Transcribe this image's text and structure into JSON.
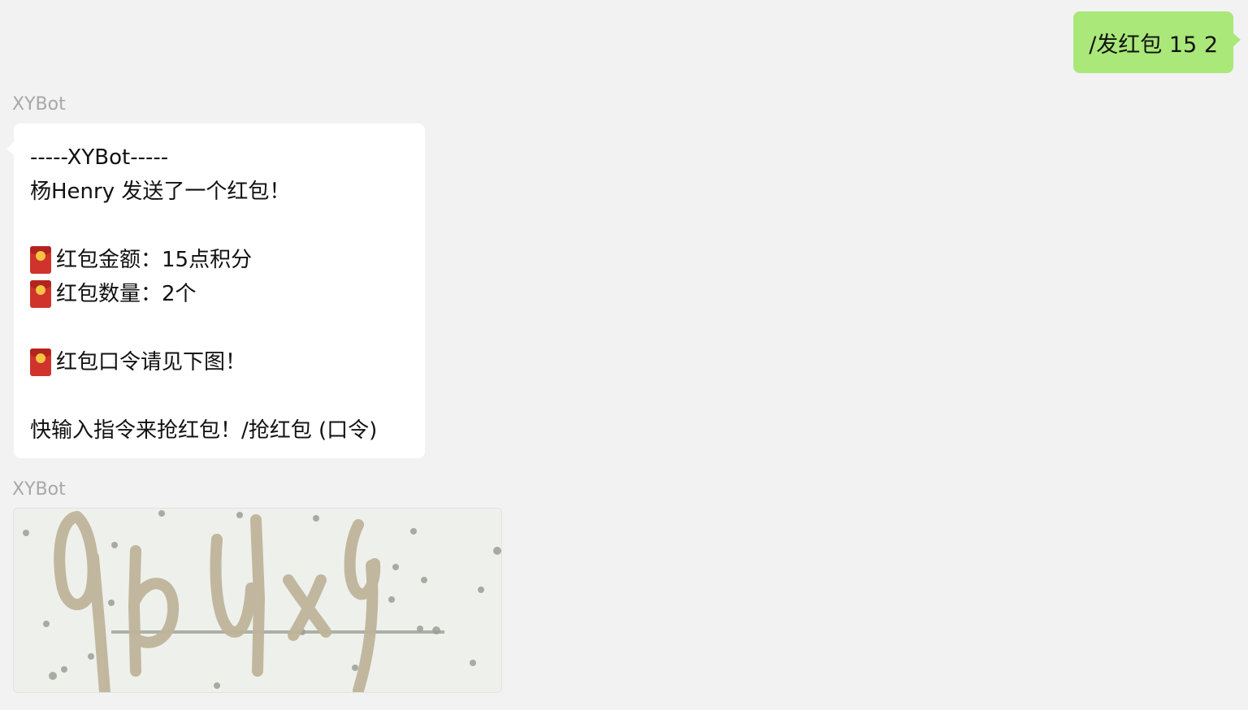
{
  "messages": {
    "outgoing": {
      "text": "/发红包 15 2"
    },
    "bot_text": {
      "sender": "XYBot",
      "header": "-----XYBot-----",
      "sent_line": "杨Henry 发送了一个红包！",
      "amount_line": "红包金额：15点积分",
      "count_line": "红包数量：2个",
      "password_line": "红包口令请见下图！",
      "instruction_line": "快输入指令来抢红包！/抢红包 (口令)"
    },
    "bot_image": {
      "sender": "XYBot",
      "image_alt": "captcha-image"
    }
  },
  "icons": {
    "red_envelope": "red-envelope-icon"
  },
  "colors": {
    "background": "#f2f2f2",
    "outgoing_bubble": "#a9e879",
    "incoming_bubble": "#ffffff",
    "sender_name": "#a7a7a7",
    "captcha_ink": "#bfb49a",
    "red_envelope": "#d0332c"
  }
}
